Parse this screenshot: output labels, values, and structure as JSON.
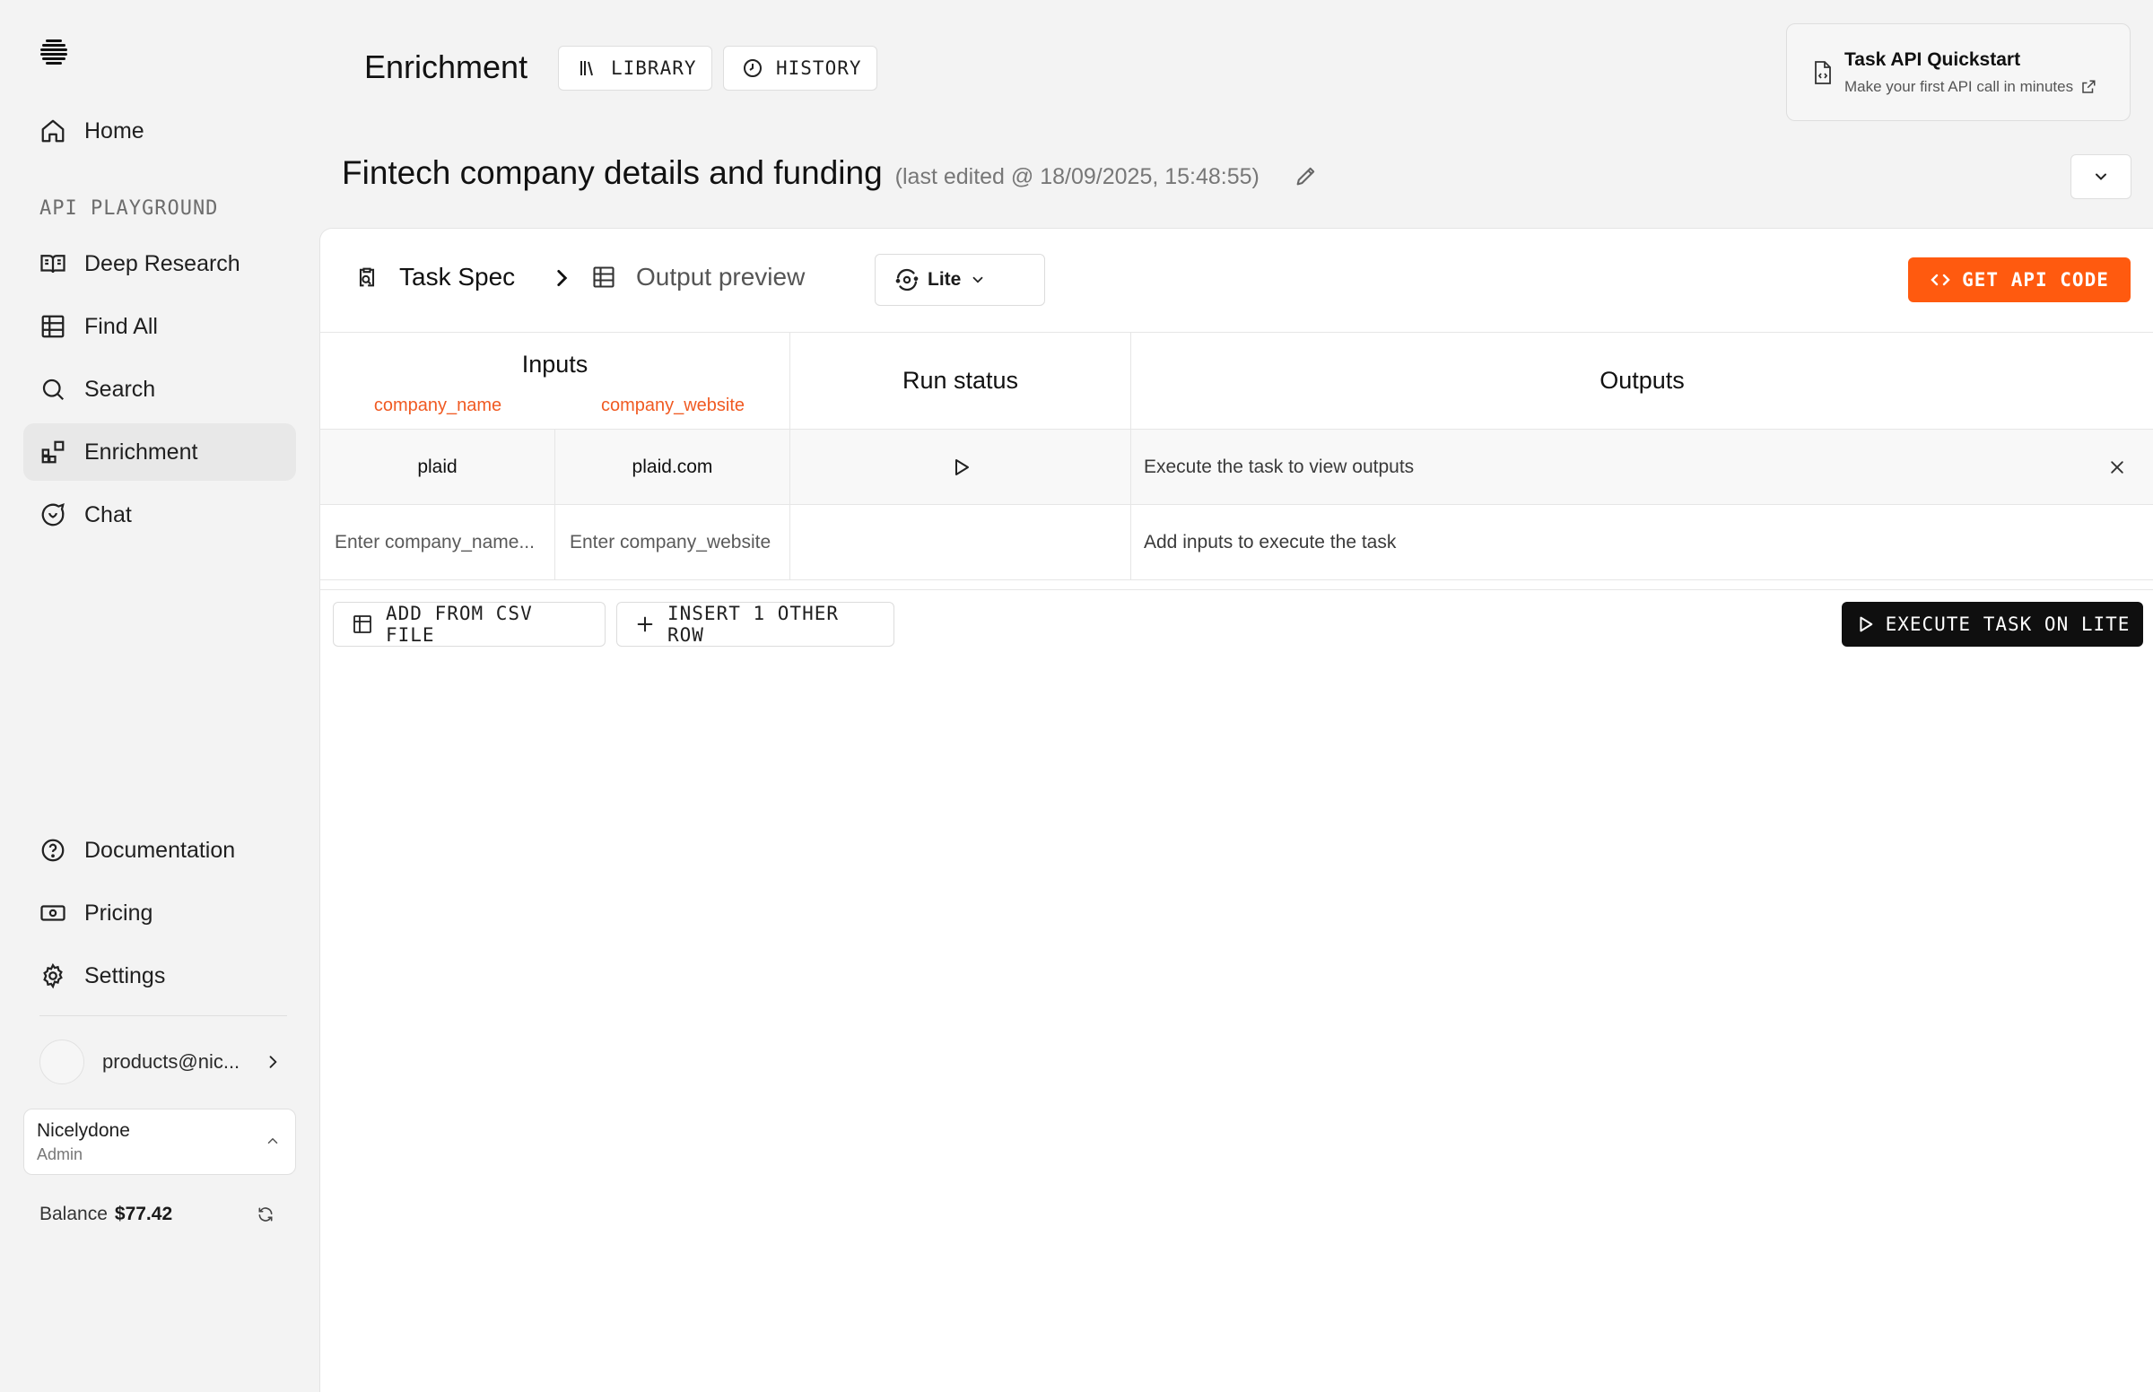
{
  "sidebar": {
    "nav_top": [
      {
        "label": "Home",
        "icon": "home-icon"
      }
    ],
    "section_label": "API PLAYGROUND",
    "nav_playground": [
      {
        "label": "Deep Research",
        "icon": "book-icon"
      },
      {
        "label": "Find All",
        "icon": "table-icon"
      },
      {
        "label": "Search",
        "icon": "search-icon"
      },
      {
        "label": "Enrichment",
        "icon": "blocks-icon",
        "active": true
      },
      {
        "label": "Chat",
        "icon": "chat-icon"
      }
    ],
    "nav_bottom": [
      {
        "label": "Documentation",
        "icon": "help-icon"
      },
      {
        "label": "Pricing",
        "icon": "banknote-icon"
      },
      {
        "label": "Settings",
        "icon": "gear-icon"
      }
    ],
    "user_email": "products@nic...",
    "org": {
      "name": "Nicelydone",
      "role": "Admin"
    },
    "balance": {
      "label": "Balance",
      "amount": "$77.42"
    }
  },
  "header": {
    "title": "Enrichment",
    "library_label": "LIBRARY",
    "history_label": "HISTORY",
    "quickstart": {
      "title": "Task API Quickstart",
      "subtitle": "Make your first API call in minutes"
    }
  },
  "task": {
    "title": "Fintech company details and funding",
    "last_edited": "(last edited @ 18/09/2025, 15:48:55)"
  },
  "toolbar": {
    "task_spec_label": "Task Spec",
    "output_preview_label": "Output preview",
    "model": "Lite",
    "api_code_label": "GET API CODE"
  },
  "table": {
    "inputs_header": "Inputs",
    "input_columns": [
      "company_name",
      "company_website"
    ],
    "run_status_header": "Run status",
    "outputs_header": "Outputs",
    "rows": [
      {
        "company_name": "plaid",
        "company_website": "plaid.com",
        "output": "Execute the task to view outputs"
      }
    ],
    "new_row": {
      "company_name_placeholder": "Enter company_name...",
      "company_website_placeholder": "Enter company_website",
      "output": "Add inputs to execute the task"
    }
  },
  "actions": {
    "csv_label": "ADD FROM CSV FILE",
    "insert_label": "INSERT 1 OTHER ROW",
    "execute_label": "EXECUTE TASK ON LITE"
  },
  "colors": {
    "accent": "#ff5a0f",
    "column_label": "#f05a22",
    "execute": "#0f0f0f"
  }
}
